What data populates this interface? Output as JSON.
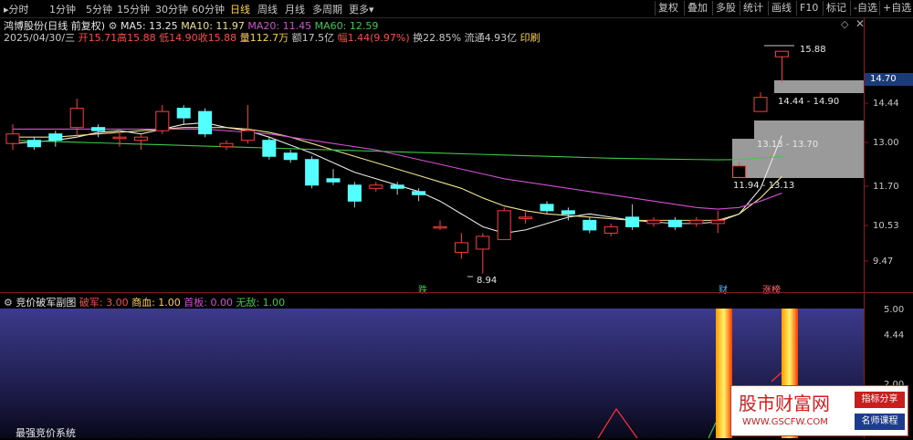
{
  "toolbar": {
    "timeframes": [
      "分时",
      "1分钟",
      "5分钟",
      "15分钟",
      "30分钟",
      "60分钟",
      "日线",
      "周线",
      "月线",
      "多周期",
      "更多"
    ],
    "active_timeframe": "日线",
    "buttons": [
      "复权",
      "叠加",
      "多股",
      "统计",
      "画线",
      "F10",
      "标记",
      "-自选",
      "+自选"
    ]
  },
  "header": {
    "stock": "鸿博股份(日线 前复权)",
    "ma5": "MA5: 13.25",
    "ma10": "MA10: 11.97",
    "ma20": "MA20: 11.45",
    "ma60": "MA60: 12.59",
    "date": "2025/04/30/三",
    "open": "开15.71",
    "high": "高15.88",
    "low": "低14.90",
    "close": "收15.88",
    "volume": "量112.7万",
    "amount": "额17.5亿",
    "change": "幅1.44(9.97%)",
    "turnover": "换22.85%",
    "float_cap": "流通4.93亿",
    "note": "印刷"
  },
  "price_axis": [
    "14.70",
    "14.44",
    "13.00",
    "11.70",
    "10.53",
    "9.47"
  ],
  "chart_labels": {
    "high_label": "15.88",
    "low_label": "8.94",
    "zone1": "14.44 - 14.90",
    "zone2": "13.13 - 13.70",
    "zone3": "11.94 - 13.13",
    "mark_die": "跌",
    "mark_cai": "财",
    "mark_zhang": "涨榜"
  },
  "sub_header": {
    "title": "竞价破军副图",
    "pojun": "破军: 3.00",
    "shangxue": "商血: 1.00",
    "shouban": "首板: 0.00",
    "wudi": "无敌: 1.00",
    "footer": "最强竞价系统"
  },
  "sub_axis": [
    "5.00",
    "4.44",
    "2.00"
  ],
  "watermark": {
    "title": "股市财富网",
    "url": "WWW.GSCFW.COM",
    "tag1": "指标分享",
    "tag2": "名师课程"
  },
  "chart_data": {
    "type": "candlestick",
    "ylim": [
      8.5,
      16.2
    ],
    "candles": [
      {
        "o": 13.0,
        "c": 13.3,
        "h": 13.6,
        "l": 12.8
      },
      {
        "o": 13.1,
        "c": 12.9,
        "h": 13.2,
        "l": 12.8
      },
      {
        "o": 13.3,
        "c": 13.1,
        "h": 13.4,
        "l": 12.9
      },
      {
        "o": 13.5,
        "c": 14.1,
        "h": 14.4,
        "l": 13.2
      },
      {
        "o": 13.5,
        "c": 13.4,
        "h": 13.6,
        "l": 13.2
      },
      {
        "o": 13.2,
        "c": 13.2,
        "h": 13.4,
        "l": 12.9
      },
      {
        "o": 13.1,
        "c": 13.2,
        "h": 13.3,
        "l": 12.8
      },
      {
        "o": 13.4,
        "c": 14.0,
        "h": 14.2,
        "l": 13.3
      },
      {
        "o": 14.1,
        "c": 13.8,
        "h": 14.2,
        "l": 13.6
      },
      {
        "o": 14.0,
        "c": 13.3,
        "h": 14.1,
        "l": 13.2
      },
      {
        "o": 12.9,
        "c": 13.0,
        "h": 13.1,
        "l": 12.8
      },
      {
        "o": 13.1,
        "c": 13.4,
        "h": 14.2,
        "l": 13.0
      },
      {
        "o": 13.1,
        "c": 12.6,
        "h": 13.2,
        "l": 12.5
      },
      {
        "o": 12.7,
        "c": 12.5,
        "h": 12.8,
        "l": 12.4
      },
      {
        "o": 12.5,
        "c": 11.7,
        "h": 12.6,
        "l": 11.6
      },
      {
        "o": 11.9,
        "c": 11.8,
        "h": 12.2,
        "l": 11.7
      },
      {
        "o": 11.7,
        "c": 11.2,
        "h": 11.8,
        "l": 11.0
      },
      {
        "o": 11.6,
        "c": 11.7,
        "h": 11.8,
        "l": 11.5
      },
      {
        "o": 11.7,
        "c": 11.6,
        "h": 11.8,
        "l": 11.4
      },
      {
        "o": 11.5,
        "c": 11.4,
        "h": 11.6,
        "l": 11.2
      },
      {
        "o": 10.4,
        "c": 10.4,
        "h": 10.6,
        "l": 10.3
      },
      {
        "o": 9.6,
        "c": 9.9,
        "h": 10.2,
        "l": 9.4
      },
      {
        "o": 9.7,
        "c": 10.1,
        "h": 10.2,
        "l": 8.94
      },
      {
        "o": 10.0,
        "c": 10.9,
        "h": 11.0,
        "l": 10.0
      },
      {
        "o": 10.7,
        "c": 10.7,
        "h": 10.9,
        "l": 10.5
      },
      {
        "o": 11.1,
        "c": 10.9,
        "h": 11.2,
        "l": 10.8
      },
      {
        "o": 10.9,
        "c": 10.8,
        "h": 11.0,
        "l": 10.6
      },
      {
        "o": 10.6,
        "c": 10.3,
        "h": 10.7,
        "l": 10.2
      },
      {
        "o": 10.2,
        "c": 10.4,
        "h": 10.5,
        "l": 10.1
      },
      {
        "o": 10.7,
        "c": 10.4,
        "h": 11.1,
        "l": 10.3
      },
      {
        "o": 10.5,
        "c": 10.6,
        "h": 10.7,
        "l": 10.4
      },
      {
        "o": 10.6,
        "c": 10.4,
        "h": 10.7,
        "l": 10.3
      },
      {
        "o": 10.5,
        "c": 10.6,
        "h": 10.7,
        "l": 10.4
      },
      {
        "o": 10.5,
        "c": 10.6,
        "h": 10.9,
        "l": 10.2
      },
      {
        "o": 11.94,
        "c": 12.3,
        "h": 12.4,
        "l": 11.94
      },
      {
        "o": 14.0,
        "c": 14.44,
        "h": 14.6,
        "l": 14.0
      },
      {
        "o": 15.71,
        "c": 15.88,
        "h": 15.88,
        "l": 14.9
      }
    ],
    "ma5": [
      13.0,
      13.05,
      13.1,
      13.2,
      13.35,
      13.4,
      13.3,
      13.45,
      13.6,
      13.65,
      13.5,
      13.4,
      13.2,
      12.95,
      12.7,
      12.4,
      12.1,
      11.9,
      11.7,
      11.5,
      11.2,
      10.8,
      10.4,
      10.2,
      10.3,
      10.5,
      10.7,
      10.8,
      10.7,
      10.6,
      10.55,
      10.5,
      10.5,
      10.55,
      10.8,
      11.6,
      13.25
    ],
    "ma10": [
      13.2,
      13.2,
      13.2,
      13.25,
      13.3,
      13.35,
      13.4,
      13.45,
      13.5,
      13.5,
      13.5,
      13.45,
      13.35,
      13.2,
      13.0,
      12.8,
      12.6,
      12.4,
      12.2,
      12.0,
      11.8,
      11.6,
      11.3,
      11.05,
      10.9,
      10.8,
      10.75,
      10.7,
      10.65,
      10.6,
      10.6,
      10.6,
      10.6,
      10.6,
      10.8,
      11.3,
      11.97
    ],
    "ma20": [
      13.45,
      13.45,
      13.45,
      13.45,
      13.45,
      13.45,
      13.45,
      13.45,
      13.45,
      13.45,
      13.4,
      13.35,
      13.3,
      13.2,
      13.1,
      13.0,
      12.9,
      12.8,
      12.65,
      12.5,
      12.35,
      12.2,
      12.05,
      11.9,
      11.8,
      11.7,
      11.6,
      11.5,
      11.4,
      11.3,
      11.2,
      11.1,
      11.0,
      10.95,
      11.0,
      11.2,
      11.45
    ],
    "ma60": [
      13.1,
      13.08,
      13.06,
      13.04,
      13.02,
      13.0,
      12.98,
      12.96,
      12.94,
      12.92,
      12.9,
      12.88,
      12.86,
      12.84,
      12.82,
      12.8,
      12.78,
      12.76,
      12.74,
      12.72,
      12.7,
      12.68,
      12.66,
      12.64,
      12.62,
      12.6,
      12.58,
      12.56,
      12.54,
      12.53,
      12.52,
      12.51,
      12.5,
      12.49,
      12.5,
      12.55,
      12.59
    ]
  }
}
